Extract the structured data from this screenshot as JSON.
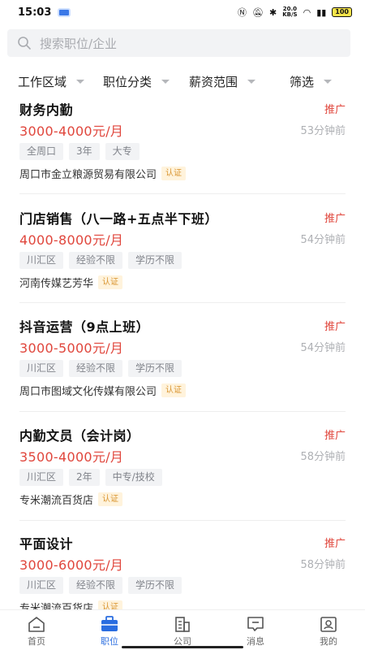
{
  "status_bar": {
    "time": "15:03",
    "net_speed_value": "20.0",
    "net_speed_unit": "KB/S",
    "battery": "100"
  },
  "search": {
    "placeholder": "搜索职位/企业"
  },
  "filters": [
    "工作区域",
    "职位分类",
    "薪资范围",
    "筛选"
  ],
  "jobs": [
    {
      "title": "财务内勤",
      "promo": "推广",
      "salary": "3000-4000元/月",
      "time": "53分钟前",
      "tags": [
        "全周口",
        "3年",
        "大专"
      ],
      "company": "周口市金立粮源贸易有限公司",
      "cert": "认证"
    },
    {
      "title": "门店销售（八一路+五点半下班）",
      "promo": "推广",
      "salary": "4000-8000元/月",
      "time": "54分钟前",
      "tags": [
        "川汇区",
        "经验不限",
        "学历不限"
      ],
      "company": "河南传媒艺芳华",
      "cert": "认证"
    },
    {
      "title": "抖音运营（9点上班）",
      "promo": "推广",
      "salary": "3000-5000元/月",
      "time": "54分钟前",
      "tags": [
        "川汇区",
        "经验不限",
        "学历不限"
      ],
      "company": "周口市图域文化传媒有限公司",
      "cert": "认证"
    },
    {
      "title": "内勤文员（会计岗）",
      "promo": "推广",
      "salary": "3500-4000元/月",
      "time": "58分钟前",
      "tags": [
        "川汇区",
        "2年",
        "中专/技校"
      ],
      "company": "专米潮流百货店",
      "cert": "认证"
    },
    {
      "title": "平面设计",
      "promo": "推广",
      "salary": "3000-6000元/月",
      "time": "58分钟前",
      "tags": [
        "川汇区",
        "经验不限",
        "学历不限"
      ],
      "company": "专米潮流百货店",
      "cert": "认证"
    }
  ],
  "tabbar": [
    {
      "label": "首页",
      "icon": "home-icon",
      "active": false
    },
    {
      "label": "职位",
      "icon": "briefcase-icon",
      "active": true
    },
    {
      "label": "公司",
      "icon": "building-icon",
      "active": false
    },
    {
      "label": "消息",
      "icon": "message-icon",
      "active": false
    },
    {
      "label": "我的",
      "icon": "profile-icon",
      "active": false
    }
  ],
  "colors": {
    "accent": "#2a6de0",
    "salary": "#e0463c",
    "cert_bg": "#fff3dc",
    "cert_text": "#d9942f"
  }
}
